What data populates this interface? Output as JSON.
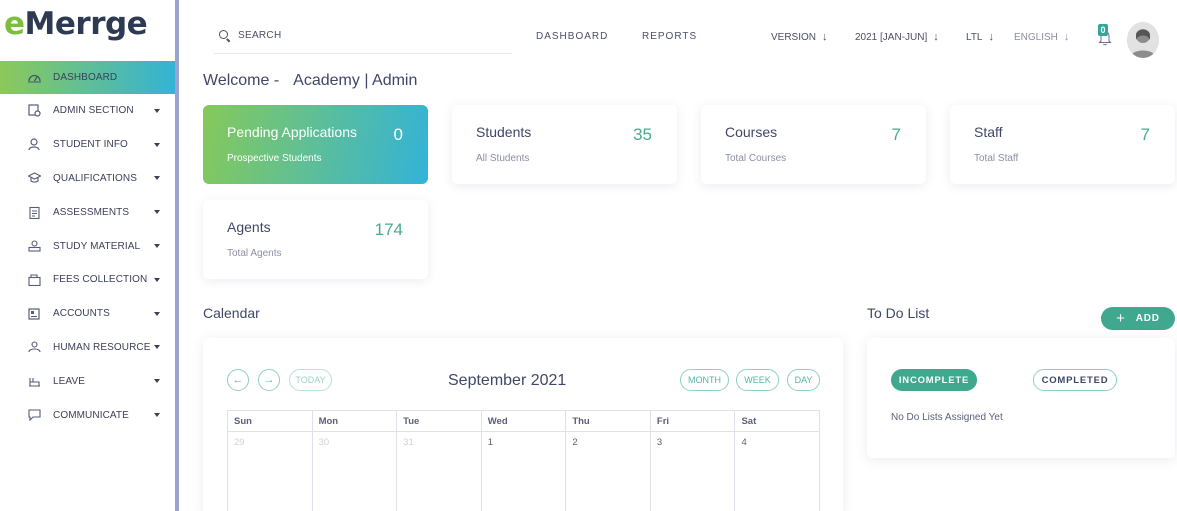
{
  "brand": {
    "logo_e": "e",
    "logo_rest": "Merrge"
  },
  "sidebar": {
    "items": [
      {
        "label": "DASHBOARD",
        "icon": "dashboard-icon",
        "active": true,
        "has_caret": false
      },
      {
        "label": "ADMIN SECTION",
        "icon": "admin-icon",
        "active": false,
        "has_caret": true
      },
      {
        "label": "STUDENT INFO",
        "icon": "user-icon",
        "active": false,
        "has_caret": true
      },
      {
        "label": "QUALIFICATIONS",
        "icon": "graduation-cap-icon",
        "active": false,
        "has_caret": true
      },
      {
        "label": "ASSESSMENTS",
        "icon": "clipboard-icon",
        "active": false,
        "has_caret": true
      },
      {
        "label": "STUDY MATERIAL",
        "icon": "book-icon",
        "active": false,
        "has_caret": true
      },
      {
        "label": "FEES COLLECTION",
        "icon": "wallet-icon",
        "active": false,
        "has_caret": true
      },
      {
        "label": "ACCOUNTS",
        "icon": "ledger-icon",
        "active": false,
        "has_caret": true
      },
      {
        "label": "HUMAN RESOURCE",
        "icon": "people-icon",
        "active": false,
        "has_caret": true
      },
      {
        "label": "LEAVE",
        "icon": "leave-icon",
        "active": false,
        "has_caret": true
      },
      {
        "label": "COMMUNICATE",
        "icon": "chat-icon",
        "active": false,
        "has_caret": true
      }
    ]
  },
  "topbar": {
    "search_placeholder": "SEARCH",
    "nav": {
      "dashboard": "DASHBOARD",
      "reports": "REPORTS"
    },
    "version_label": "VERSION",
    "session_label": "2021 [JAN-JUN]",
    "currency_label": "LTL",
    "language_label": "ENGLISH",
    "notification_count": "0"
  },
  "welcome": {
    "prefix": "Welcome -",
    "context": "Academy | Admin"
  },
  "stats": {
    "pending": {
      "title": "Pending Applications",
      "subtitle": "Prospective Students",
      "value": "0"
    },
    "students": {
      "title": "Students",
      "subtitle": "All Students",
      "value": "35"
    },
    "courses": {
      "title": "Courses",
      "subtitle": "Total Courses",
      "value": "7"
    },
    "staff": {
      "title": "Staff",
      "subtitle": "Total Staff",
      "value": "7"
    },
    "agents": {
      "title": "Agents",
      "subtitle": "Total Agents",
      "value": "174"
    }
  },
  "calendar": {
    "title": "Calendar",
    "today_label": "TODAY",
    "month_label": "September 2021",
    "views": {
      "month": "MONTH",
      "week": "WEEK",
      "day": "DAY"
    },
    "weekdays": [
      "Sun",
      "Mon",
      "Tue",
      "Wed",
      "Thu",
      "Fri",
      "Sat"
    ],
    "first_week": [
      "29",
      "30",
      "31",
      "1",
      "2",
      "3",
      "4"
    ]
  },
  "todo": {
    "title": "To Do List",
    "add_label": "ADD",
    "tab_incomplete": "INCOMPLETE",
    "tab_completed": "COMPLETED",
    "empty_text": "No Do Lists Assigned Yet"
  },
  "colors": {
    "accent": "#3fa88e",
    "gradient_start": "#86c95a",
    "gradient_end": "#33b3d8",
    "text": "#3f4767"
  }
}
